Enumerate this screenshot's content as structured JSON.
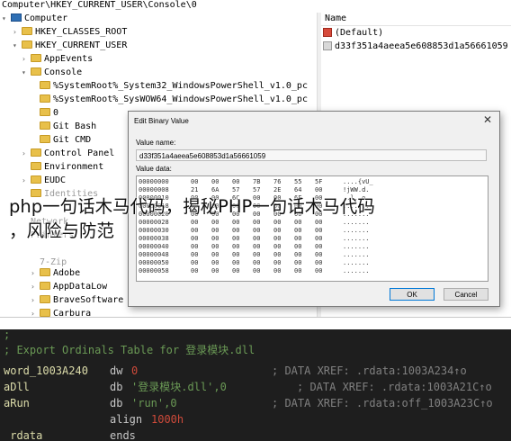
{
  "registry": {
    "address_bar": "Computer\\HKEY_CURRENT_USER\\Console\\0",
    "tree": [
      {
        "label": "Computer",
        "icon": "computer-icon",
        "caret": "▾",
        "faded": false
      },
      {
        "label": "HKEY_CLASSES_ROOT",
        "icon": "folder-icon",
        "caret": "›",
        "faded": false
      },
      {
        "label": "HKEY_CURRENT_USER",
        "icon": "folder-icon",
        "caret": "▾",
        "faded": false
      },
      {
        "label": "AppEvents",
        "icon": "folder-icon",
        "caret": "›",
        "faded": false
      },
      {
        "label": "Console",
        "icon": "folder-icon",
        "caret": "▾",
        "faded": false
      },
      {
        "label": "%SystemRoot%_System32_WindowsPowerShell_v1.0_pc",
        "icon": "folder-icon",
        "caret": "",
        "faded": false
      },
      {
        "label": "%SystemRoot%_SysWOW64_WindowsPowerShell_v1.0_pc",
        "icon": "folder-icon",
        "caret": "",
        "faded": false
      },
      {
        "label": "0",
        "icon": "folder-icon",
        "caret": "",
        "faded": false
      },
      {
        "label": "Git Bash",
        "icon": "folder-icon",
        "caret": "",
        "faded": false
      },
      {
        "label": "Git CMD",
        "icon": "folder-icon",
        "caret": "",
        "faded": false
      },
      {
        "label": "Control Panel",
        "icon": "folder-icon",
        "caret": "›",
        "faded": false
      },
      {
        "label": "Environment",
        "icon": "folder-icon",
        "caret": "",
        "faded": false
      },
      {
        "label": "EUDC",
        "icon": "folder-icon",
        "caret": "›",
        "faded": false
      },
      {
        "label": "Identities",
        "icon": "folder-icon",
        "caret": "",
        "faded": true
      },
      {
        "label": "",
        "icon": "folder-icon",
        "caret": "",
        "faded": true
      },
      {
        "label": "Network",
        "icon": "folder-icon",
        "caret": "",
        "faded": true
      },
      {
        "label": "Printers",
        "icon": "folder-icon",
        "caret": "",
        "faded": true
      },
      {
        "label": "",
        "icon": "folder-icon",
        "caret": "",
        "faded": true
      },
      {
        "label": "7-Zip",
        "icon": "folder-icon",
        "caret": "",
        "faded": true
      },
      {
        "label": "Adobe",
        "icon": "folder-icon",
        "caret": "›",
        "faded": false
      },
      {
        "label": "AppDataLow",
        "icon": "folder-icon",
        "caret": "›",
        "faded": false
      },
      {
        "label": "BraveSoftware",
        "icon": "folder-icon",
        "caret": "›",
        "faded": false
      },
      {
        "label": "Carbura",
        "icon": "folder-icon",
        "caret": "›",
        "faded": false
      }
    ],
    "values_header": "Name",
    "values": [
      {
        "name": "(Default)",
        "icon": "string-value-icon"
      },
      {
        "name": "d33f351a4aeea5e608853d1a56661059",
        "icon": "binary-value-icon"
      }
    ]
  },
  "dialog": {
    "title": "Edit Binary Value",
    "close_glyph": "✕",
    "value_name_label": "Value name:",
    "value_name": "d33f351a4aeea5e608853d1a56661059",
    "value_data_label": "Value data:",
    "hex_rows": [
      {
        "offset": "00000000",
        "bytes": [
          "00",
          "00",
          "00",
          "7B",
          "76",
          "55",
          "5F"
        ],
        "ascii": "....{vU_"
      },
      {
        "offset": "00000008",
        "bytes": [
          "21",
          "6A",
          "57",
          "57",
          "2E",
          "64",
          "00"
        ],
        "ascii": "!jWW.d."
      },
      {
        "offset": "00000010",
        "bytes": [
          "00",
          "00",
          "6C",
          "00",
          "00",
          "6F",
          "00"
        ],
        "ascii": "..l..o."
      },
      {
        "offset": "00000018",
        "bytes": [
          "00",
          "00",
          "00",
          "00",
          "00",
          "00",
          "00"
        ],
        "ascii": "......."
      },
      {
        "offset": "00000020",
        "bytes": [
          "00",
          "00",
          "00",
          "00",
          "00",
          "00",
          "00"
        ],
        "ascii": "......."
      },
      {
        "offset": "00000028",
        "bytes": [
          "00",
          "00",
          "00",
          "00",
          "00",
          "00",
          "00"
        ],
        "ascii": "......."
      },
      {
        "offset": "00000030",
        "bytes": [
          "00",
          "00",
          "00",
          "00",
          "00",
          "00",
          "00"
        ],
        "ascii": "......."
      },
      {
        "offset": "00000038",
        "bytes": [
          "00",
          "00",
          "00",
          "00",
          "00",
          "00",
          "00"
        ],
        "ascii": "......."
      },
      {
        "offset": "00000040",
        "bytes": [
          "00",
          "00",
          "00",
          "00",
          "00",
          "00",
          "00"
        ],
        "ascii": "......."
      },
      {
        "offset": "00000048",
        "bytes": [
          "00",
          "00",
          "00",
          "00",
          "00",
          "00",
          "00"
        ],
        "ascii": "......."
      },
      {
        "offset": "00000050",
        "bytes": [
          "00",
          "00",
          "00",
          "00",
          "00",
          "00",
          "00"
        ],
        "ascii": "......."
      },
      {
        "offset": "00000058",
        "bytes": [
          "00",
          "00",
          "00",
          "00",
          "00",
          "00",
          "00"
        ],
        "ascii": "......."
      }
    ],
    "ok_label": "OK",
    "cancel_label": "Cancel"
  },
  "caption": {
    "line1": "php一句话木马代码，揭秘PHP一句话木马代码",
    "line2": "，风险与防范"
  },
  "code": {
    "separator": ";",
    "comment": "; Export Ordinals Table for 登录模块.dll",
    "rows": [
      {
        "label": "word_1003A240",
        "op": "dw",
        "arg": "0",
        "xref": "; DATA XREF: .rdata:1003A234↑o"
      },
      {
        "label": "aDll",
        "op": "db",
        "arg": "'登录模块.dll',0",
        "xref": "; DATA XREF: .rdata:1003A21C↑o"
      },
      {
        "label": "aRun",
        "op": "db",
        "arg": "'run',0",
        "xref": "; DATA XREF: .rdata:off_1003A23C↑o"
      },
      {
        "label": "",
        "op": "align",
        "arg": "1000h",
        "xref": ""
      },
      {
        "label": "_rdata",
        "op": "ends",
        "arg": "",
        "xref": ""
      }
    ]
  }
}
